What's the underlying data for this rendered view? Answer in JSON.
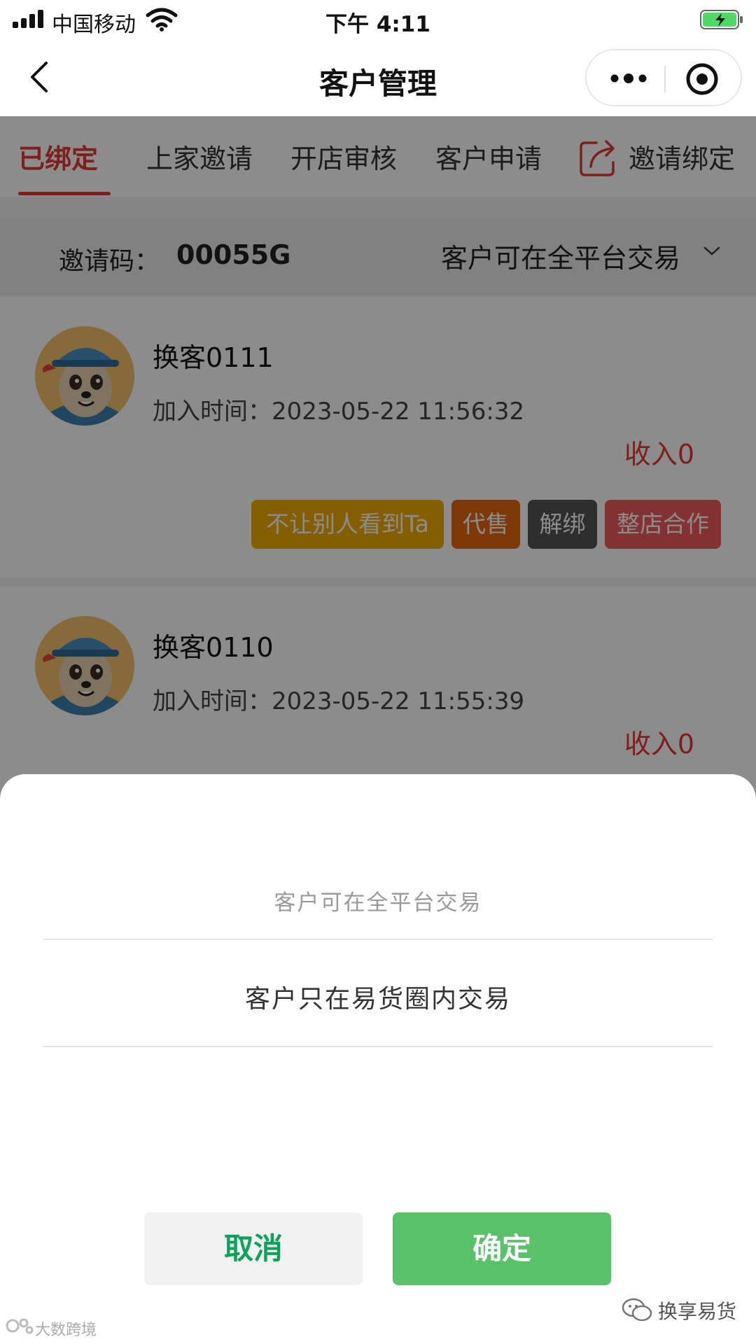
{
  "status_bar": {
    "carrier": "中国移动",
    "time": "下午 4:11"
  },
  "nav": {
    "title": "客户管理",
    "icons": [
      "back-icon",
      "more-icon",
      "target-icon"
    ]
  },
  "tabs": {
    "items": [
      "已绑定",
      "上家邀请",
      "开店审核",
      "客户申请"
    ],
    "active": "已绑定",
    "invite_bind": "邀请绑定"
  },
  "invite": {
    "label": "邀请码：",
    "code": "00055G",
    "scope": "客户可在全平台交易"
  },
  "customers": [
    {
      "name": "换客0111",
      "join_label": "加入时间：",
      "join_time": "2023-05-22 11:56:32",
      "income": "收入0",
      "buttons": [
        "不让别人看到Ta",
        "代售",
        "解绑",
        "整店合作"
      ]
    },
    {
      "name": "换客0110",
      "join_label": "加入时间：",
      "join_time": "2023-05-22 11:55:39",
      "income": "收入0"
    }
  ],
  "sheet": {
    "options": [
      "客户可在全平台交易",
      "客户只在易货圈内交易"
    ],
    "cancel": "取消",
    "confirm": "确定"
  },
  "footer": {
    "account": "换享易货",
    "watermark": "大数跨境"
  },
  "colors": {
    "accent_red": "#e53935",
    "confirm_green": "#5ac16b",
    "cancel_text_green": "#07a35a",
    "btn_hide": "#f2ab00",
    "btn_consign": "#e8690f",
    "btn_unbind": "#555555",
    "btn_coop": "#f05a5a"
  }
}
